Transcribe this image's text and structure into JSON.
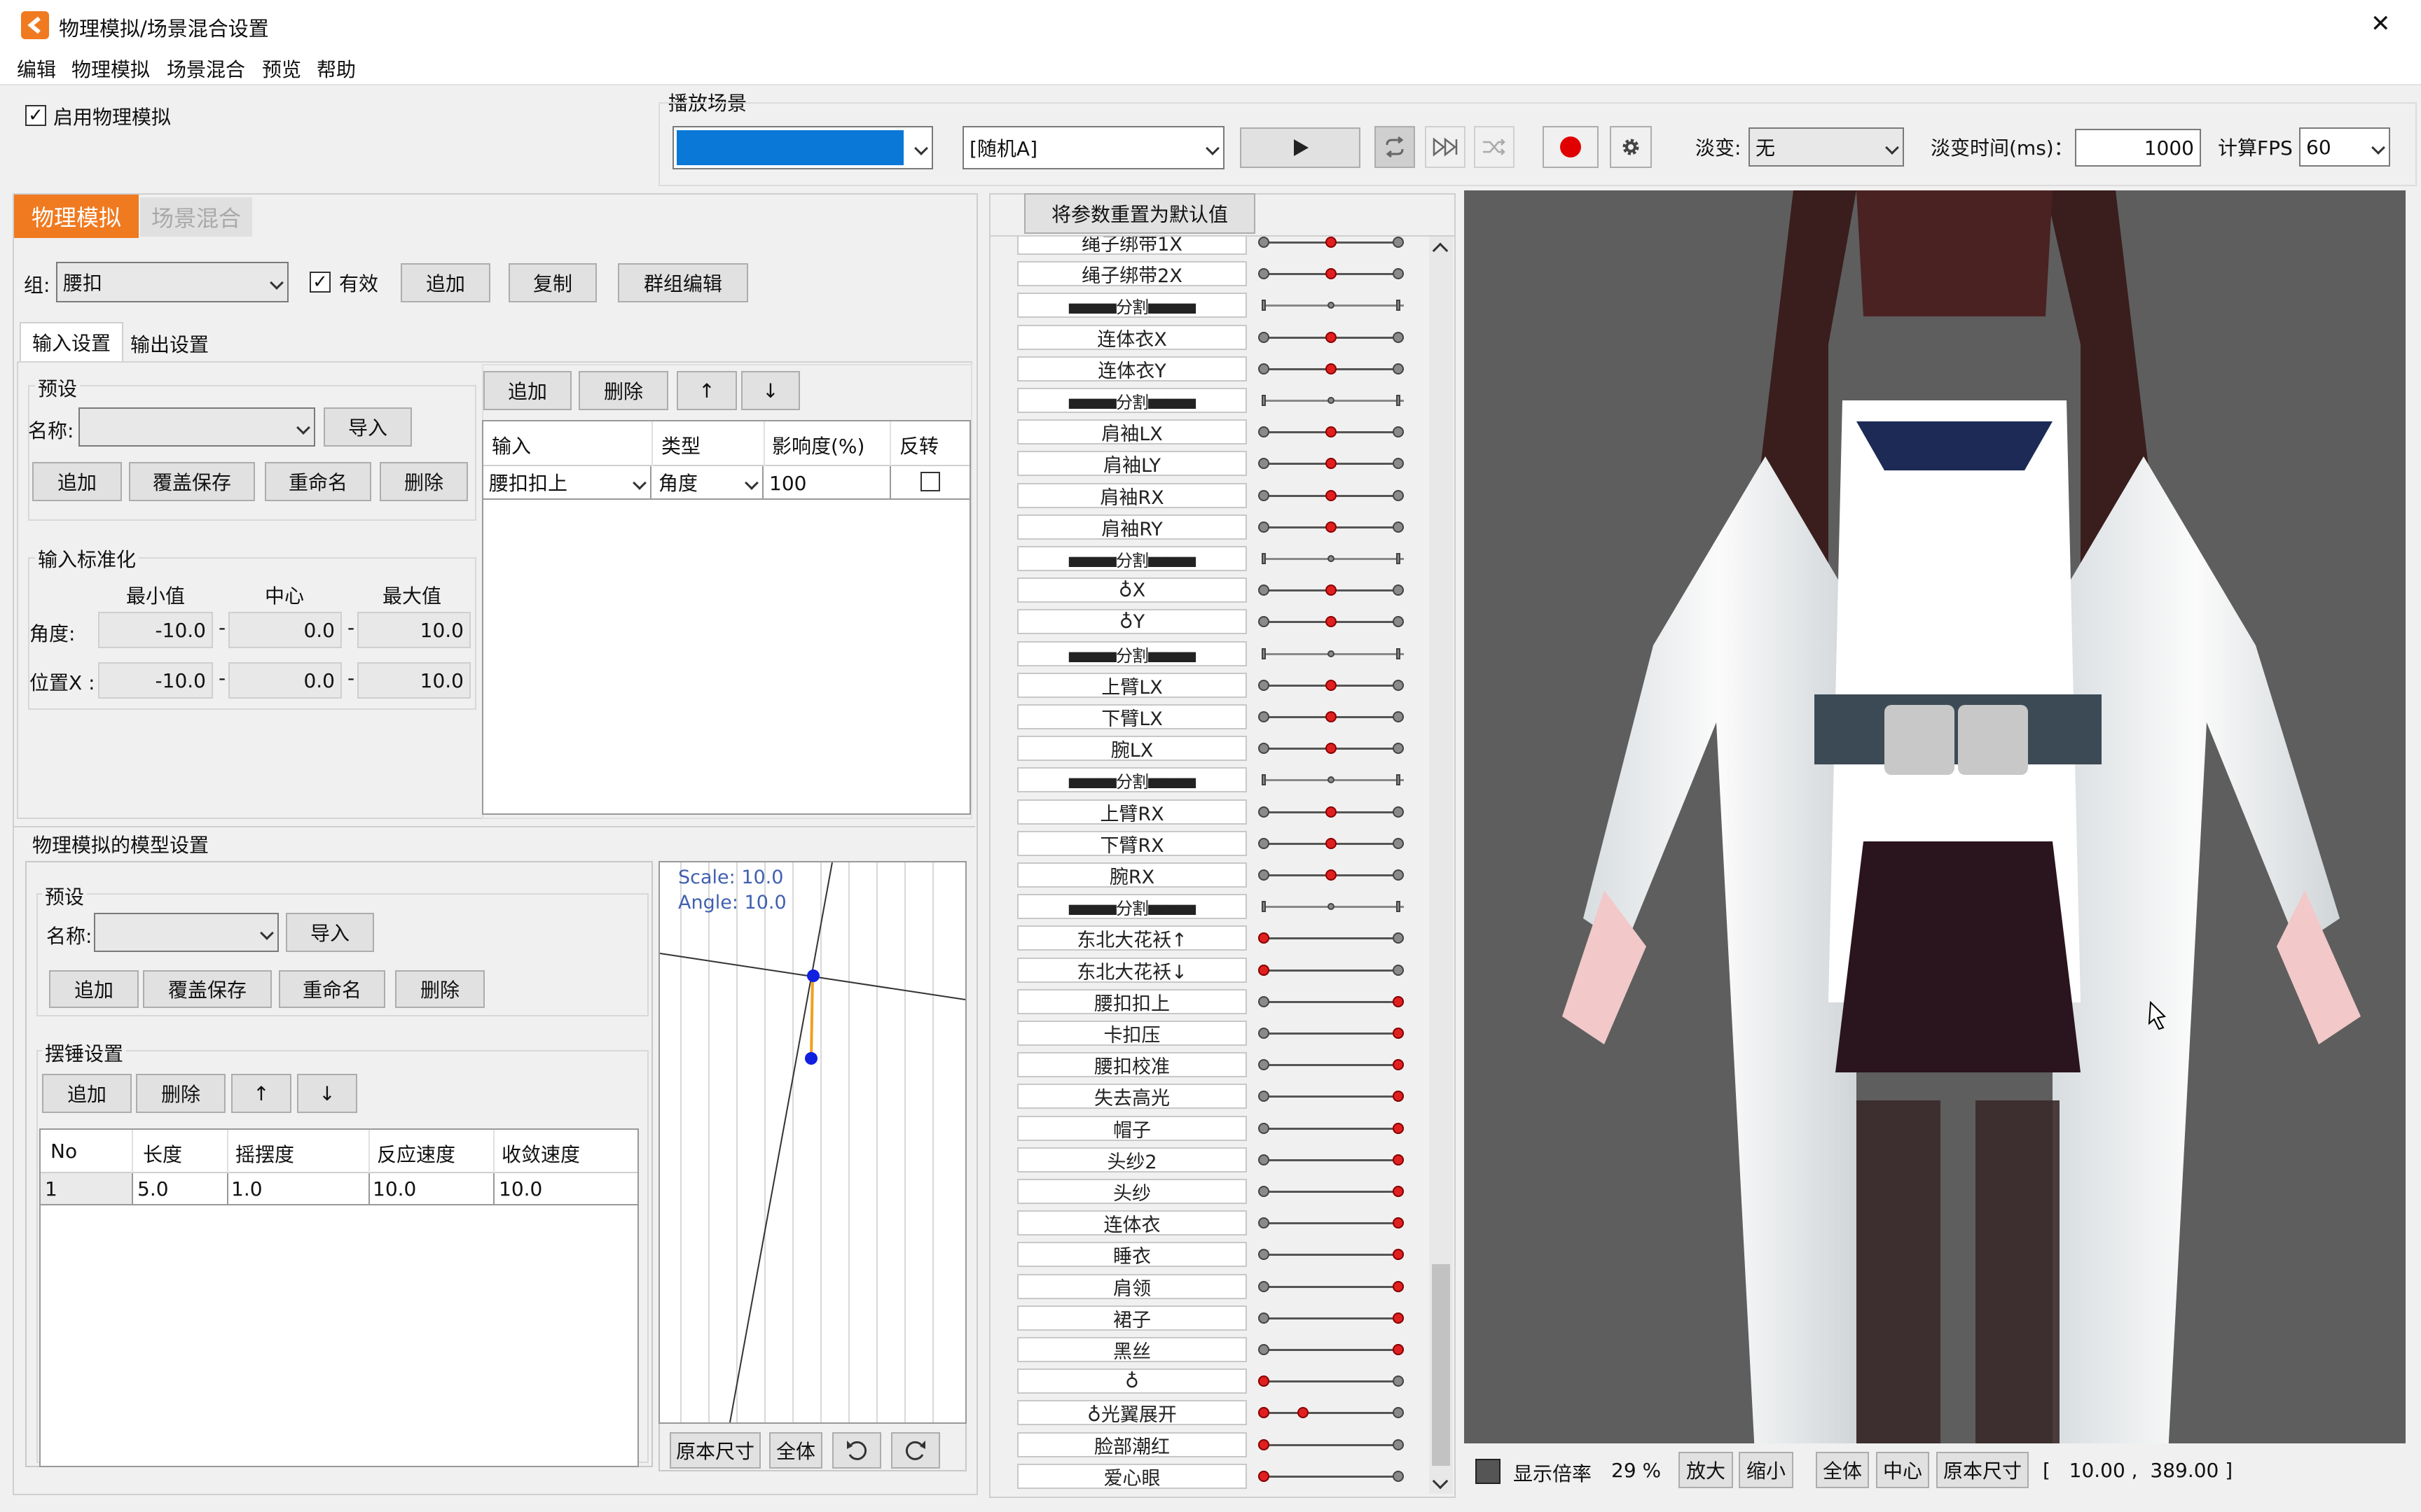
{
  "window": {
    "title": "物理模拟/场景混合设置",
    "close": "✕"
  },
  "menu": [
    "编辑",
    "物理模拟",
    "场景混合",
    "预览",
    "帮助"
  ],
  "enable_physics": "启用物理模拟",
  "playback": {
    "group_label": "播放场景",
    "scene_value": "",
    "random_value": "[随机A]",
    "fade_label": "淡变:",
    "fade_value": "无",
    "fade_time_label": "淡变时间(ms)：",
    "fade_time_value": "1000",
    "fps_label": "计算FPS",
    "fps_value": "60"
  },
  "main_tabs": [
    "物理模拟",
    "场景混合"
  ],
  "group_row": {
    "label": "组:",
    "value": "腰扣",
    "valid_label": "有效",
    "add": "追加",
    "copy": "复制",
    "bulk_edit": "群组编辑"
  },
  "sub_tabs": [
    "输入设置",
    "输出设置"
  ],
  "preset": {
    "title": "预设",
    "name_label": "名称:",
    "import": "导入",
    "add": "追加",
    "overwrite": "覆盖保存",
    "rename": "重命名",
    "delete": "删除"
  },
  "normalize": {
    "title": "输入标准化",
    "headers": [
      "最小值",
      "中心",
      "最大值"
    ],
    "rows": [
      {
        "label": "角度:",
        "min": "-10.0",
        "center": "0.0",
        "max": "10.0"
      },
      {
        "label": "位置X :",
        "min": "-10.0",
        "center": "0.0",
        "max": "10.0"
      }
    ]
  },
  "input_table": {
    "add": "追加",
    "delete": "删除",
    "up": "↑",
    "down": "↓",
    "headers": [
      "输入",
      "类型",
      "影响度(%)",
      "反转"
    ],
    "rows": [
      {
        "input": "腰扣扣上",
        "type": "角度",
        "influence": "100"
      }
    ]
  },
  "model_settings": {
    "title": "物理模拟的模型设置",
    "preset_title": "预设",
    "name_label": "名称:",
    "import": "导入",
    "add": "追加",
    "overwrite": "覆盖保存",
    "rename": "重命名",
    "delete": "删除",
    "pendulum_title": "摆锤设置",
    "p_add": "追加",
    "p_delete": "删除",
    "p_up": "↑",
    "p_down": "↓",
    "headers": [
      "No",
      "长度",
      "摇摆度",
      "反应速度",
      "收敛速度"
    ],
    "rows": [
      {
        "no": "1",
        "length": "5.0",
        "sway": "1.0",
        "react": "10.0",
        "converge": "10.0"
      }
    ]
  },
  "pendulum_view": {
    "scale": "Scale: 10.0",
    "angle": "Angle: 10.0",
    "original": "原本尺寸",
    "all": "全体"
  },
  "params": {
    "reset": "将参数重置为默认值",
    "rows": [
      {
        "label": "绳子绑带1X",
        "kind": "mid"
      },
      {
        "label": "绳子绑带2X",
        "kind": "mid"
      },
      {
        "label": "■■■■■分割■■■■■",
        "kind": "sep"
      },
      {
        "label": "连体衣X",
        "kind": "mid"
      },
      {
        "label": "连体衣Y",
        "kind": "mid"
      },
      {
        "label": "■■■■■分割■■■■■",
        "kind": "sep"
      },
      {
        "label": "肩袖LX",
        "kind": "mid"
      },
      {
        "label": "肩袖LY",
        "kind": "mid"
      },
      {
        "label": "肩袖RX",
        "kind": "mid"
      },
      {
        "label": "肩袖RY",
        "kind": "mid"
      },
      {
        "label": "■■■■■分割■■■■■",
        "kind": "sep"
      },
      {
        "label": "♁X",
        "kind": "mid"
      },
      {
        "label": "♁Y",
        "kind": "mid"
      },
      {
        "label": "■■■■■分割■■■■■",
        "kind": "sep"
      },
      {
        "label": "上臂LX",
        "kind": "mid"
      },
      {
        "label": "下臂LX",
        "kind": "mid"
      },
      {
        "label": "腕LX",
        "kind": "mid"
      },
      {
        "label": "■■■■■分割■■■■■",
        "kind": "sep"
      },
      {
        "label": "上臂RX",
        "kind": "mid"
      },
      {
        "label": "下臂RX",
        "kind": "mid"
      },
      {
        "label": "腕RX",
        "kind": "mid"
      },
      {
        "label": "■■■■■分割■■■■■",
        "kind": "sep"
      },
      {
        "label": "东北大花袄↑",
        "kind": "left"
      },
      {
        "label": "东北大花袄↓",
        "kind": "left"
      },
      {
        "label": "腰扣扣上",
        "kind": "right"
      },
      {
        "label": "卡扣压",
        "kind": "right"
      },
      {
        "label": "腰扣校准",
        "kind": "right"
      },
      {
        "label": "失去高光",
        "kind": "right"
      },
      {
        "label": "帽子",
        "kind": "right"
      },
      {
        "label": "头纱2",
        "kind": "right"
      },
      {
        "label": "头纱",
        "kind": "right"
      },
      {
        "label": "连体衣",
        "kind": "right"
      },
      {
        "label": "睡衣",
        "kind": "right"
      },
      {
        "label": "肩领",
        "kind": "right"
      },
      {
        "label": "裙子",
        "kind": "right"
      },
      {
        "label": "黑丝",
        "kind": "right"
      },
      {
        "label": "♁",
        "kind": "left"
      },
      {
        "label": "♁光翼展开",
        "kind": "quarter"
      },
      {
        "label": "脸部潮红",
        "kind": "left"
      },
      {
        "label": "爱心眼",
        "kind": "left"
      }
    ]
  },
  "preview": {
    "show_zoom": "显示倍率",
    "zoom": "29 %",
    "zoom_in": "放大",
    "zoom_out": "缩小",
    "all": "全体",
    "center": "中心",
    "original": "原本尺寸",
    "coords": "[   10.00 ,  389.00 ]"
  },
  "colors": {
    "accent": "#f07a20",
    "scene_blue": "#0a78d7",
    "record_red": "#e00000"
  }
}
